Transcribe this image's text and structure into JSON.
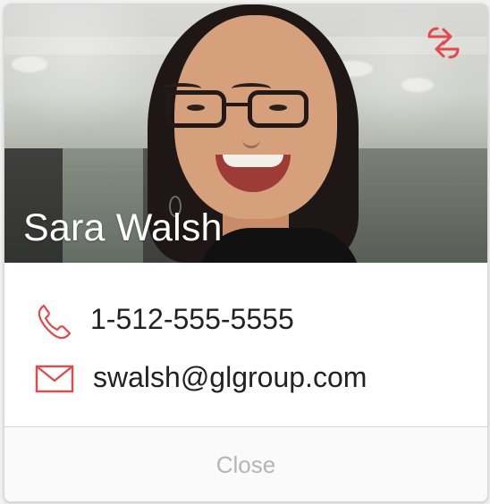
{
  "profile": {
    "name": "Sara Walsh"
  },
  "header": {
    "switch_icon": "swap-arrows-icon",
    "accent_color": "#e2494c"
  },
  "contact": {
    "phone_icon": "phone-icon",
    "phone": "1-512-555-5555",
    "email_icon": "mail-icon",
    "email": "swalsh@glgroup.com"
  },
  "footer": {
    "close_label": "Close"
  }
}
